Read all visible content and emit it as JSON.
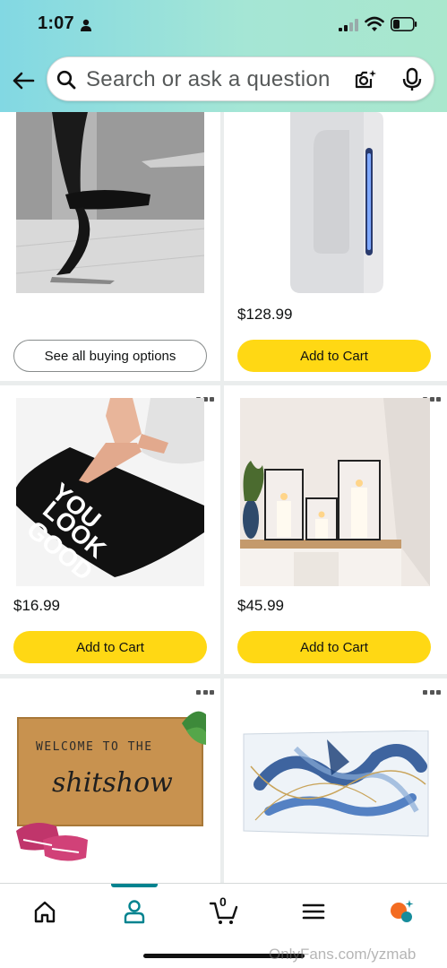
{
  "status_bar": {
    "time": "1:07"
  },
  "search": {
    "placeholder": "Search or ask a question"
  },
  "products": [
    {
      "price": "",
      "button": "See all buying options"
    },
    {
      "price": "$128.99",
      "button": "Add to Cart"
    },
    {
      "price": "$16.99",
      "button": "Add to Cart",
      "image_text": [
        "YOU",
        "LOOK",
        "GOOD"
      ]
    },
    {
      "price": "$45.99",
      "button": "Add to Cart"
    },
    {
      "image_text": [
        "WELCOME TO THE",
        "shitshow"
      ]
    },
    {}
  ],
  "bottom_nav": {
    "cart_count": "0"
  },
  "watermark": "OnlyFans.com/yzmab",
  "colors": {
    "accent": "#00838f",
    "button_yellow": "#ffd814",
    "header_start": "#82d8e3",
    "header_end": "#a9e7cd"
  }
}
